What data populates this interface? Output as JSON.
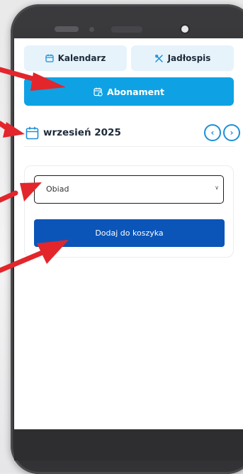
{
  "tabs": {
    "calendar": {
      "label": "Kalendarz",
      "icon": "calendar-icon"
    },
    "menu": {
      "label": "Jadłospis",
      "icon": "cutlery-icon"
    }
  },
  "subscription_button": {
    "label": "Abonament",
    "icon": "calendar-check-icon"
  },
  "month": {
    "label": "wrzesień 2025",
    "icon": "calendar-icon"
  },
  "navigation": {
    "prev_icon": "chevron-left-icon",
    "next_icon": "chevron-right-icon"
  },
  "meal_select": {
    "value": "Obiad"
  },
  "add_to_cart": {
    "label": "Dodaj do koszyka"
  },
  "colors": {
    "accent": "#1b8fd6",
    "subscription_bg": "#0ea2e5",
    "cart_bg": "#0b55b8",
    "tab_bg": "#e6f3fb",
    "arrow": "#e2262b"
  }
}
